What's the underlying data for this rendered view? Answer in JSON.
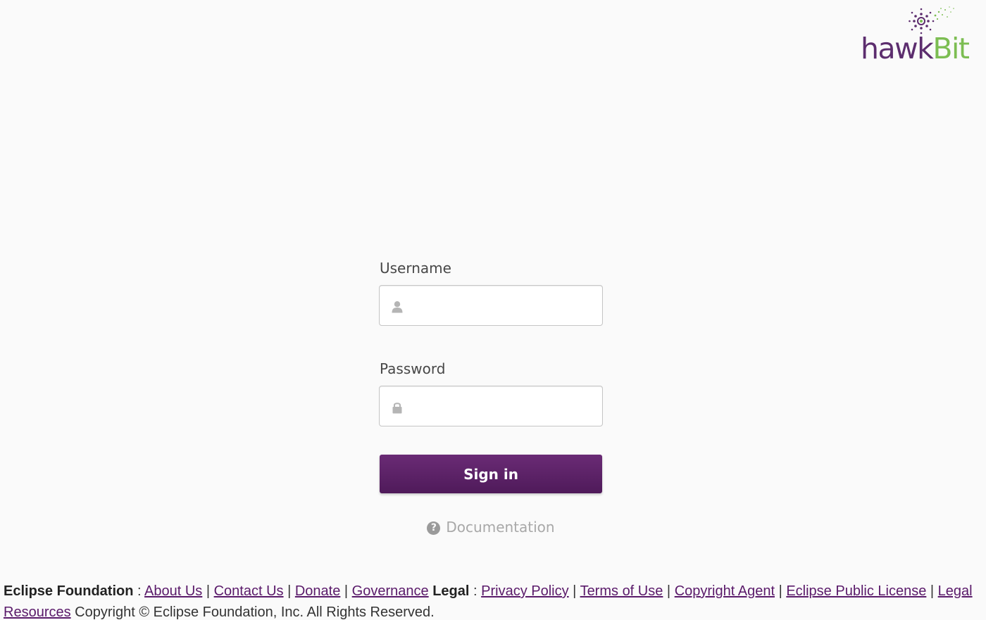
{
  "logo": {
    "text_part1": "hawk",
    "text_part2": "Bit"
  },
  "login": {
    "username_label": "Username",
    "username_value": "",
    "password_label": "Password",
    "password_value": "",
    "signin_label": "Sign in",
    "documentation_label": "Documentation"
  },
  "icons": {
    "username": "user-icon",
    "password": "lock-icon",
    "documentation": "question-circle-icon"
  },
  "colors": {
    "brand_purple": "#5c2d6e",
    "brand_green": "#7cbd52",
    "button": "#5e2268"
  },
  "footer": {
    "foundation_heading": "Eclipse Foundation",
    "sep_colon": " : ",
    "links_foundation": [
      "About Us",
      "Contact Us",
      "Donate",
      "Governance"
    ],
    "legal_heading": "Legal",
    "links_legal": [
      "Privacy Policy",
      "Terms of Use",
      "Copyright Agent",
      "Eclipse Public License",
      "Legal Resources"
    ],
    "copyright": "Copyright © Eclipse Foundation, Inc. All Rights Reserved."
  }
}
